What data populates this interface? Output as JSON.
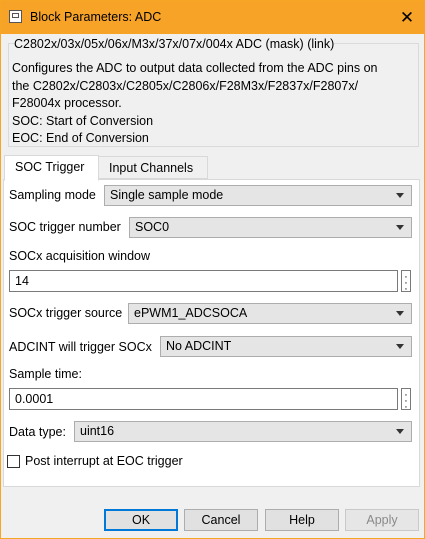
{
  "window": {
    "title": "Block Parameters: ADC",
    "close_glyph": "✕"
  },
  "group": {
    "title": "C2802x/03x/05x/06x/M3x/37x/07x/004x ADC (mask) (link)",
    "description": "Configures the ADC to output data collected from the ADC pins on\nthe C2802x/C2803x/C2805x/C2806x/F28M3x/F2837x/F2807x/\nF28004x processor.\nSOC: Start of Conversion\nEOC: End of Conversion"
  },
  "tabs": [
    {
      "label": "SOC Trigger",
      "active": true
    },
    {
      "label": "Input Channels",
      "active": false
    }
  ],
  "params": {
    "sampling_mode": {
      "label": "Sampling mode",
      "value": "Single sample mode"
    },
    "soc_trigger_number": {
      "label": "SOC trigger number",
      "value": "SOC0"
    },
    "acq_window": {
      "label": "SOCx acquisition window",
      "value": "14"
    },
    "trigger_source": {
      "label": "SOCx trigger source",
      "value": "ePWM1_ADCSOCA"
    },
    "adcint_trigger": {
      "label": "ADCINT will trigger SOCx",
      "value": "No ADCINT"
    },
    "sample_time": {
      "label": "Sample time:",
      "value": "0.0001"
    },
    "data_type": {
      "label": "Data type:",
      "value": "uint16"
    },
    "post_interrupt": {
      "label": "Post interrupt at EOC trigger",
      "checked": false
    }
  },
  "buttons": {
    "ok": "OK",
    "cancel": "Cancel",
    "help": "Help",
    "apply": "Apply"
  },
  "colors": {
    "titlebar": "#f7a328",
    "primary_border": "#0078d7"
  }
}
